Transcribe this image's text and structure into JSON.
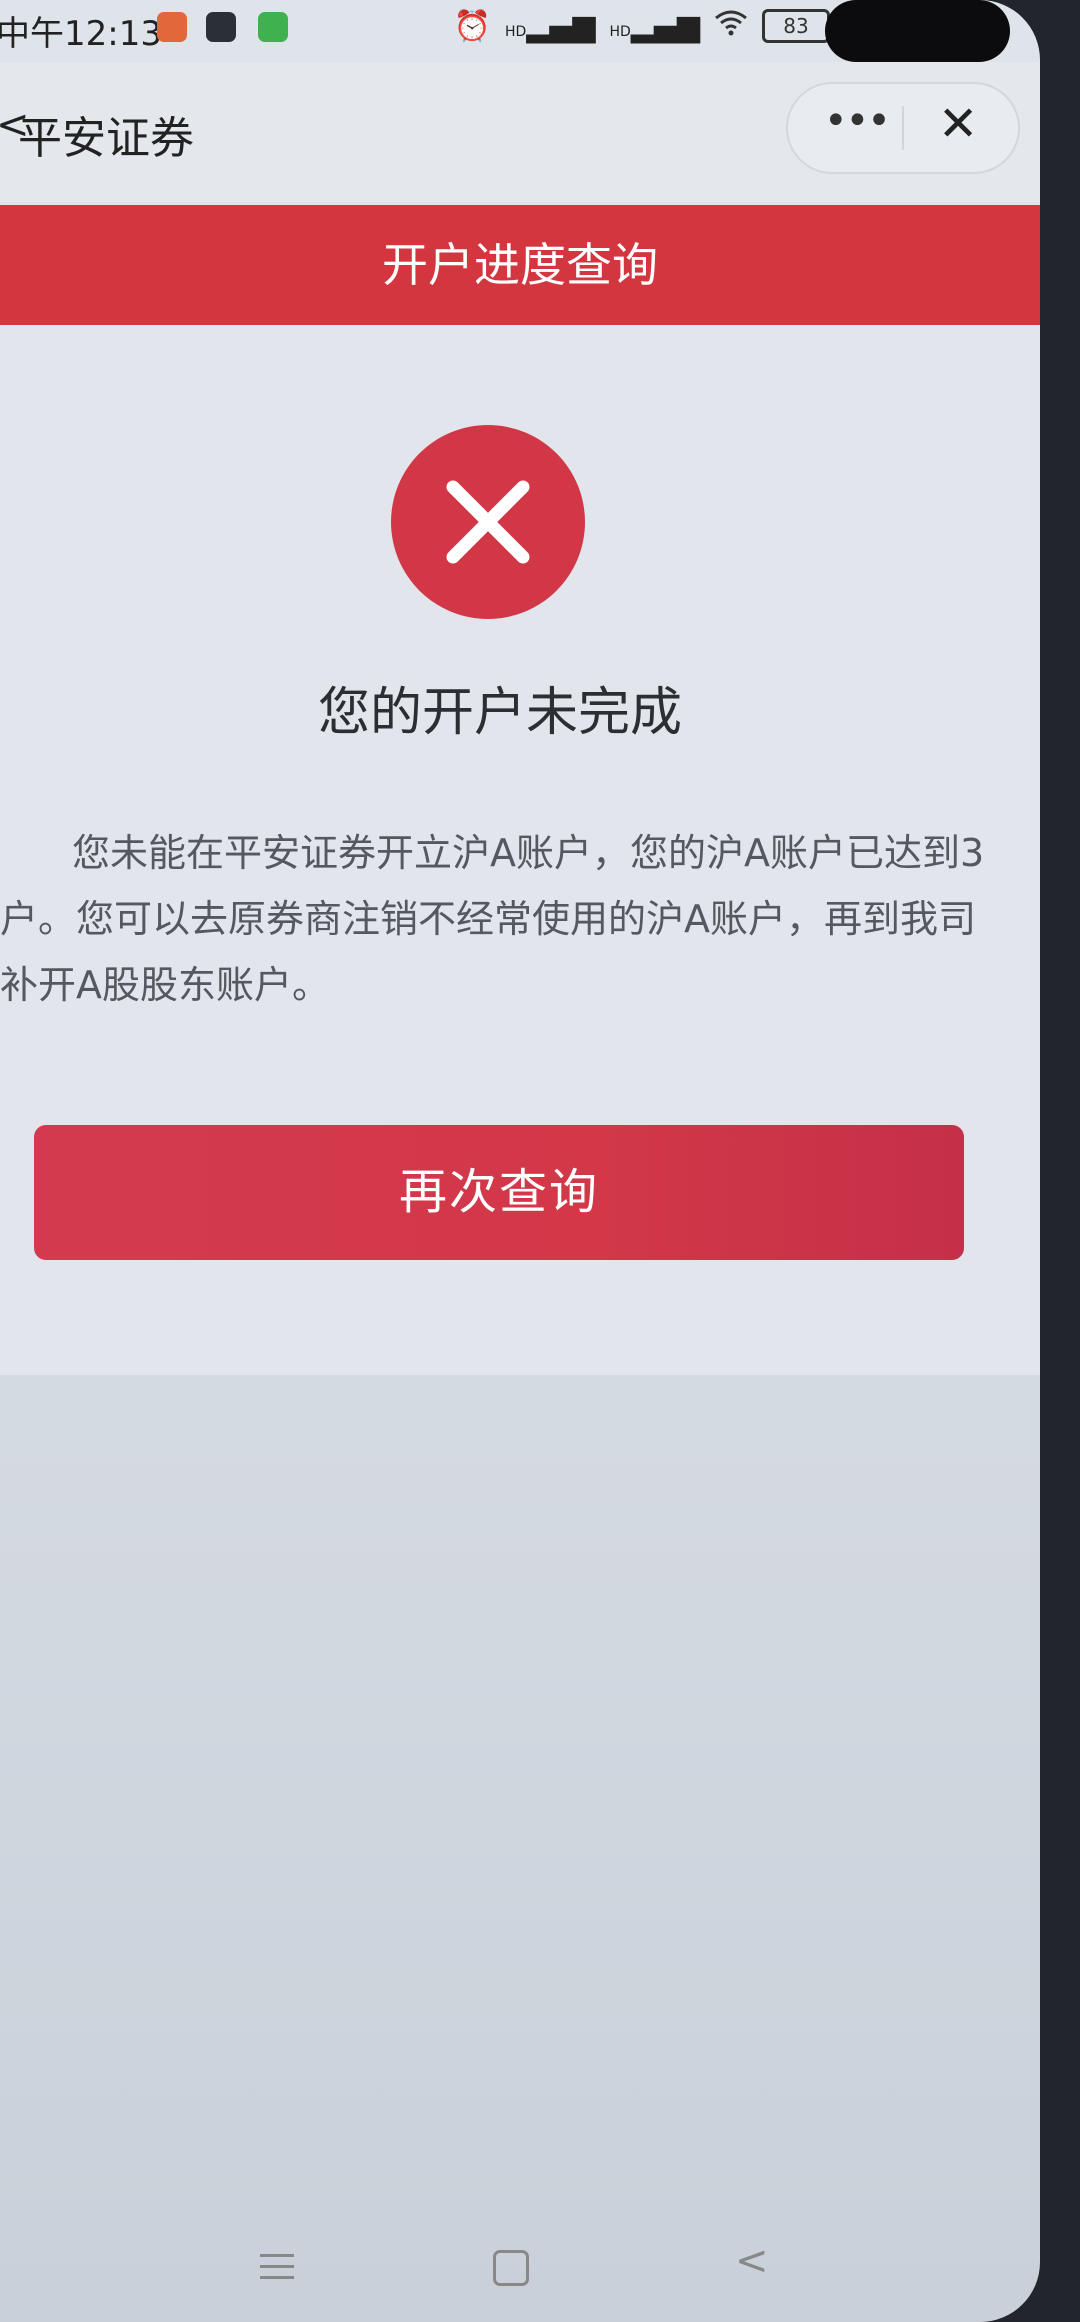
{
  "status_bar": {
    "time": "中午12:13",
    "signal_1": "HD",
    "signal_2": "HD",
    "battery": "83"
  },
  "nav_bar": {
    "back_glyph": "<",
    "title": "平安证券",
    "more_glyph": "•••",
    "close_glyph": "✕"
  },
  "page": {
    "header_title": "开户进度查询",
    "result_icon": "error-icon",
    "result_title": "您的开户未完成",
    "result_description": "您未能在平安证券开立沪A账户，您的沪A账户已达到3户。您可以去原券商注销不经常使用的沪A账户，再到我司补开A股股东账户。",
    "retry_button_label": "再次查询"
  },
  "system_nav": {
    "back_glyph": "<"
  },
  "colors": {
    "brand_red": "#d3363f",
    "button_red": "#d23848",
    "page_bg": "#e2e6ec"
  }
}
